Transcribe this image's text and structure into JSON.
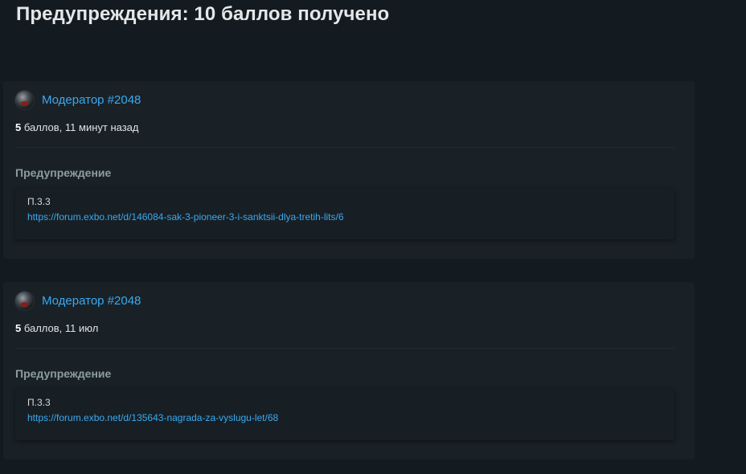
{
  "page": {
    "title": "Предупреждения: 10 баллов получено"
  },
  "warnings": [
    {
      "moderator": "Модератор #2048",
      "points": "5",
      "meta_rest": " баллов, 11 минут назад",
      "section_title": "Предупреждение",
      "reason_text": "П.3.3",
      "reason_link": "https://forum.exbo.net/d/146084-sak-3-pioneer-3-i-sanktsii-dlya-tretih-lits/6"
    },
    {
      "moderator": "Модератор #2048",
      "points": "5",
      "meta_rest": " баллов, 11 июл",
      "section_title": "Предупреждение",
      "reason_text": "П.3.3",
      "reason_link": "https://forum.exbo.net/d/135643-nagrada-za-vyslugu-let/68"
    }
  ],
  "colors": {
    "background": "#141b20",
    "card": "#192126",
    "link": "#3aa9f0",
    "heading_muted": "#8e9ba3"
  },
  "icons": {
    "avatar": "moderator-avatar"
  }
}
